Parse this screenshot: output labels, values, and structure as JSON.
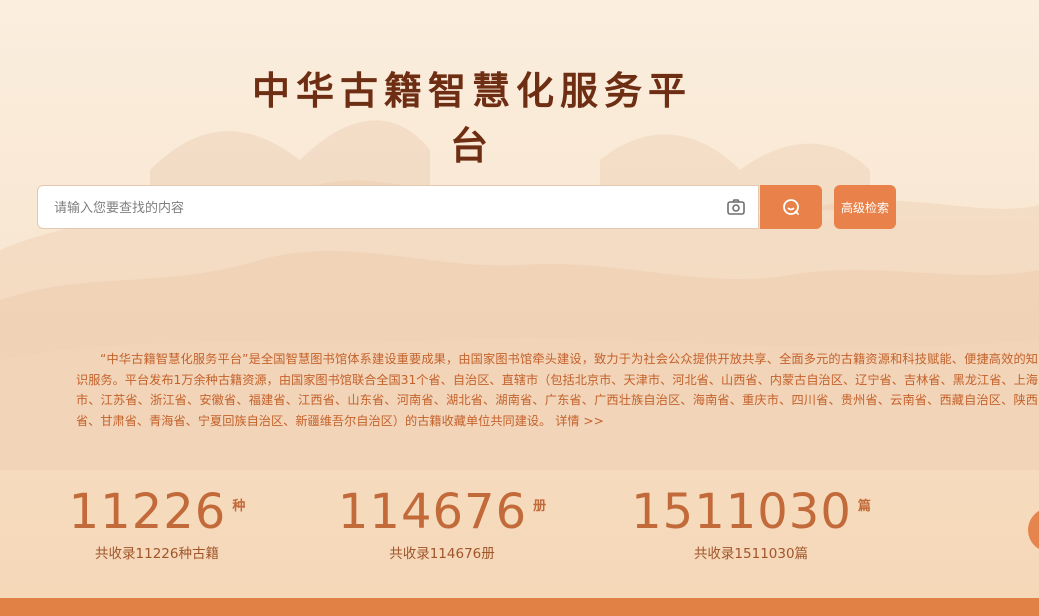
{
  "title": "中华古籍智慧化服务平台",
  "search": {
    "placeholder": "请输入您要查找的内容",
    "advanced_label": "高级检索"
  },
  "intro": {
    "text": "“中华古籍智慧化服务平台”是全国智慧图书馆体系建设重要成果，由国家图书馆牵头建设，致力于为社会公众提供开放共享、全面多元的古籍资源和科技赋能、便捷高效的知识服务。平台发布1万余种古籍资源，由国家图书馆联合全国31个省、自治区、直辖市（包括北京市、天津市、河北省、山西省、内蒙古自治区、辽宁省、吉林省、黑龙江省、上海市、江苏省、浙江省、安徽省、福建省、江西省、山东省、河南省、湖北省、湖南省、广东省、广西壮族自治区、海南省、重庆市、四川省、贵州省、云南省、西藏自治区、陕西省、甘肃省、青海省、宁夏回族自治区、新疆维吾尔自治区）的古籍收藏单位共同建设。",
    "more_label": "详情 >>"
  },
  "stats": [
    {
      "value": "11226",
      "unit": "种",
      "desc": "共收录11226种古籍"
    },
    {
      "value": "114676",
      "unit": "册",
      "desc": "共收录114676册"
    },
    {
      "value": "1511030",
      "unit": "篇",
      "desc": "共收录1511030篇"
    }
  ],
  "colors": {
    "accent": "#e8824a",
    "title": "#6e2e14",
    "intro_text": "#c4622b",
    "stat_text": "#c26a3a"
  },
  "icons": {
    "camera": "camera-icon",
    "search": "search-icon"
  }
}
